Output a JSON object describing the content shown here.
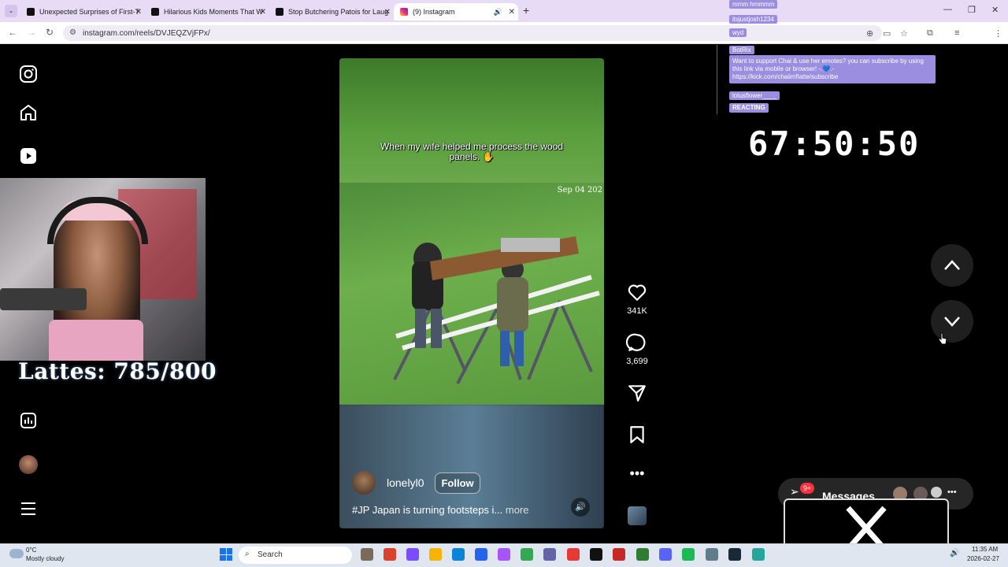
{
  "browser": {
    "tabs": [
      {
        "title": "Unexpected Surprises of First-T",
        "icon": "tiktok-icon"
      },
      {
        "title": "Hilarious Kids Moments That W",
        "icon": "tiktok-icon"
      },
      {
        "title": "Stop Butchering Patois for Laug",
        "icon": "tiktok-icon"
      },
      {
        "title": "(9) Instagram",
        "icon": "instagram-icon"
      }
    ],
    "url": "instagram.com/reels/DVJEQZVjFPx/"
  },
  "reel": {
    "caption": "When my wife helped me process the wood panels.",
    "caption_emoji": "✋",
    "date": "Sep 04 202",
    "username": "lonelyl0",
    "follow_label": "Follow",
    "description": "#JP Japan is turning footsteps i...",
    "more_label": "more",
    "likes": "341K",
    "comments": "3,699"
  },
  "stream": {
    "lattes": "Lattes: 785/800",
    "timer": "67:50:50",
    "chat": {
      "names": [
        "mmm hmmmm",
        "itsjustjosh1234",
        "wyd",
        "BotRix",
        "lotusflower____",
        "REACTING"
      ],
      "message": "Want to support Chai & use her emotes? you can subscribe by using this link via mobile or browser! -.💙.- https://kick.com/chaiimflatte/subscribe"
    }
  },
  "messages": {
    "label": "Messages",
    "badge": "9+"
  },
  "taskbar": {
    "weather_temp": "0°C",
    "weather_desc": "Mostly cloudy",
    "search_label": "Search",
    "time": "11:35 AM",
    "date": "2026-02-27"
  },
  "colors": {
    "chrome_tab_bg": "#e7dbf5",
    "chat_accent": "#9b8ee0",
    "badge_red": "#ff3040"
  }
}
